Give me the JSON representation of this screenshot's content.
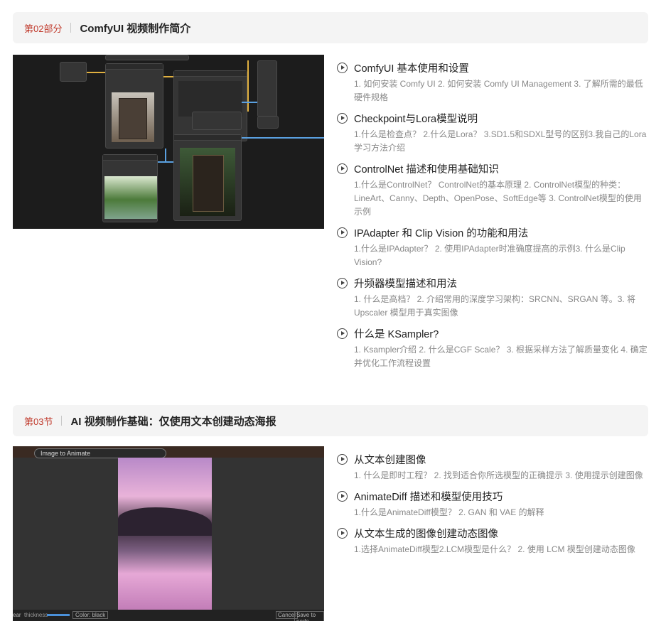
{
  "section2": {
    "tag": "第02部分",
    "title": "ComfyUI 视频制作简介",
    "lessons": [
      {
        "title": "ComfyUI 基本使用和设置",
        "desc": "1. 如何安装 Comfy UI 2. 如何安装 Comfy UI Management 3. 了解所需的最低硬件规格"
      },
      {
        "title": "Checkpoint与Lora模型说明",
        "desc": "1.什么是检查点？ 2.什么是Lora？ 3.SD1.5和SDXL型号的区别3.我自己的Lora学习方法介绍"
      },
      {
        "title": "ControlNet 描述和使用基础知识",
        "desc": "1.什么是ControlNet？ ControlNet的基本原理 2. ControlNet模型的种类：LineArt、Canny、Depth、OpenPose、SoftEdge等 3. ControlNet模型的使用示例"
      },
      {
        "title": "IPAdapter 和 Clip Vision 的功能和用法",
        "desc": "1.什么是IPAdapter？ 2. 使用IPAdapter时准确度提高的示例3. 什么是Clip Vision?"
      },
      {
        "title": "升频器模型描述和用法",
        "desc": "1. 什么是高档？ 2. 介绍常用的深度学习架构：SRCNN、SRGAN 等。3. 将Upscaler 模型用于真实图像"
      },
      {
        "title": "什么是 KSampler?",
        "desc": "1. Ksampler介绍 2. 什么是CGF Scale？ 3. 根据采样方法了解质量变化 4. 确定并优化工作流程设置"
      }
    ]
  },
  "section3": {
    "tag": "第03节",
    "title": "AI 视频制作基础：仅使用文本创建动态海报",
    "lessons": [
      {
        "title": "从文本创建图像",
        "desc": "1. 什么是即时工程？ 2. 找到适合你所选模型的正确提示 3. 使用提示创建图像"
      },
      {
        "title": "AnimateDiff 描述和模型使用技巧",
        "desc": "1.什么是AnimateDiff模型？ 2. GAN 和 VAE 的解释"
      },
      {
        "title": "从文本生成的图像创建动态图像",
        "desc": "1.选择AnimateDiff模型2.LCM模型是什么？ 2. 使用 LCM 模型创建动态图像"
      }
    ]
  },
  "editor": {
    "node_label": "Image to Animate",
    "clear": "ear",
    "thickness": "thickness",
    "color": "Color: black",
    "cancel": "Cancel",
    "save": "Save to node"
  },
  "colors": {
    "accent": "#c0392b",
    "wire_blue": "#5aa0e0",
    "wire_yellow": "#e0b040"
  }
}
